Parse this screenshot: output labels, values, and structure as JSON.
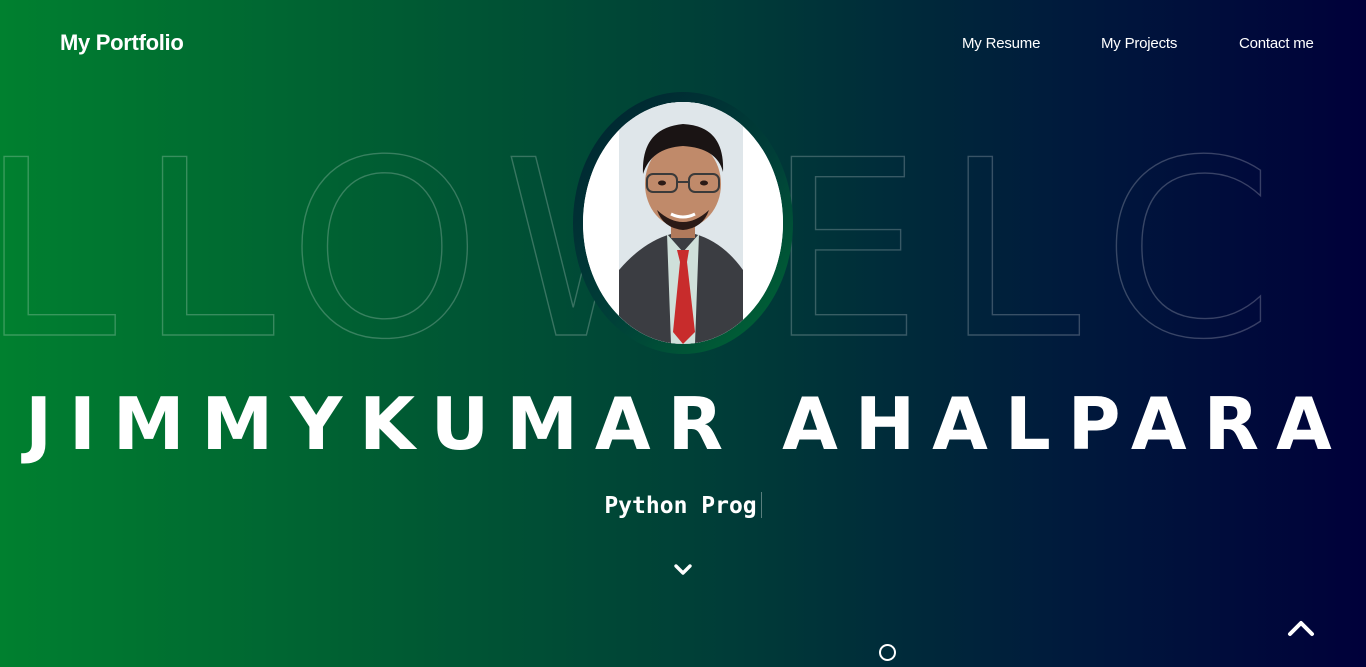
{
  "nav": {
    "brand": "My Portfolio",
    "links": [
      {
        "label": "My Resume"
      },
      {
        "label": "My Projects"
      },
      {
        "label": "Contact me"
      }
    ]
  },
  "hero": {
    "background_word": "LLOWELC",
    "name": "JIMMYKUMAR AHALPARA",
    "role_typed": "Python Prog",
    "scroll_down_icon": "chevron-down-icon",
    "back_to_top_icon": "chevron-up-icon"
  },
  "colors": {
    "gradient_start": "#00802f",
    "gradient_end": "#00003a",
    "text": "#ffffff"
  }
}
